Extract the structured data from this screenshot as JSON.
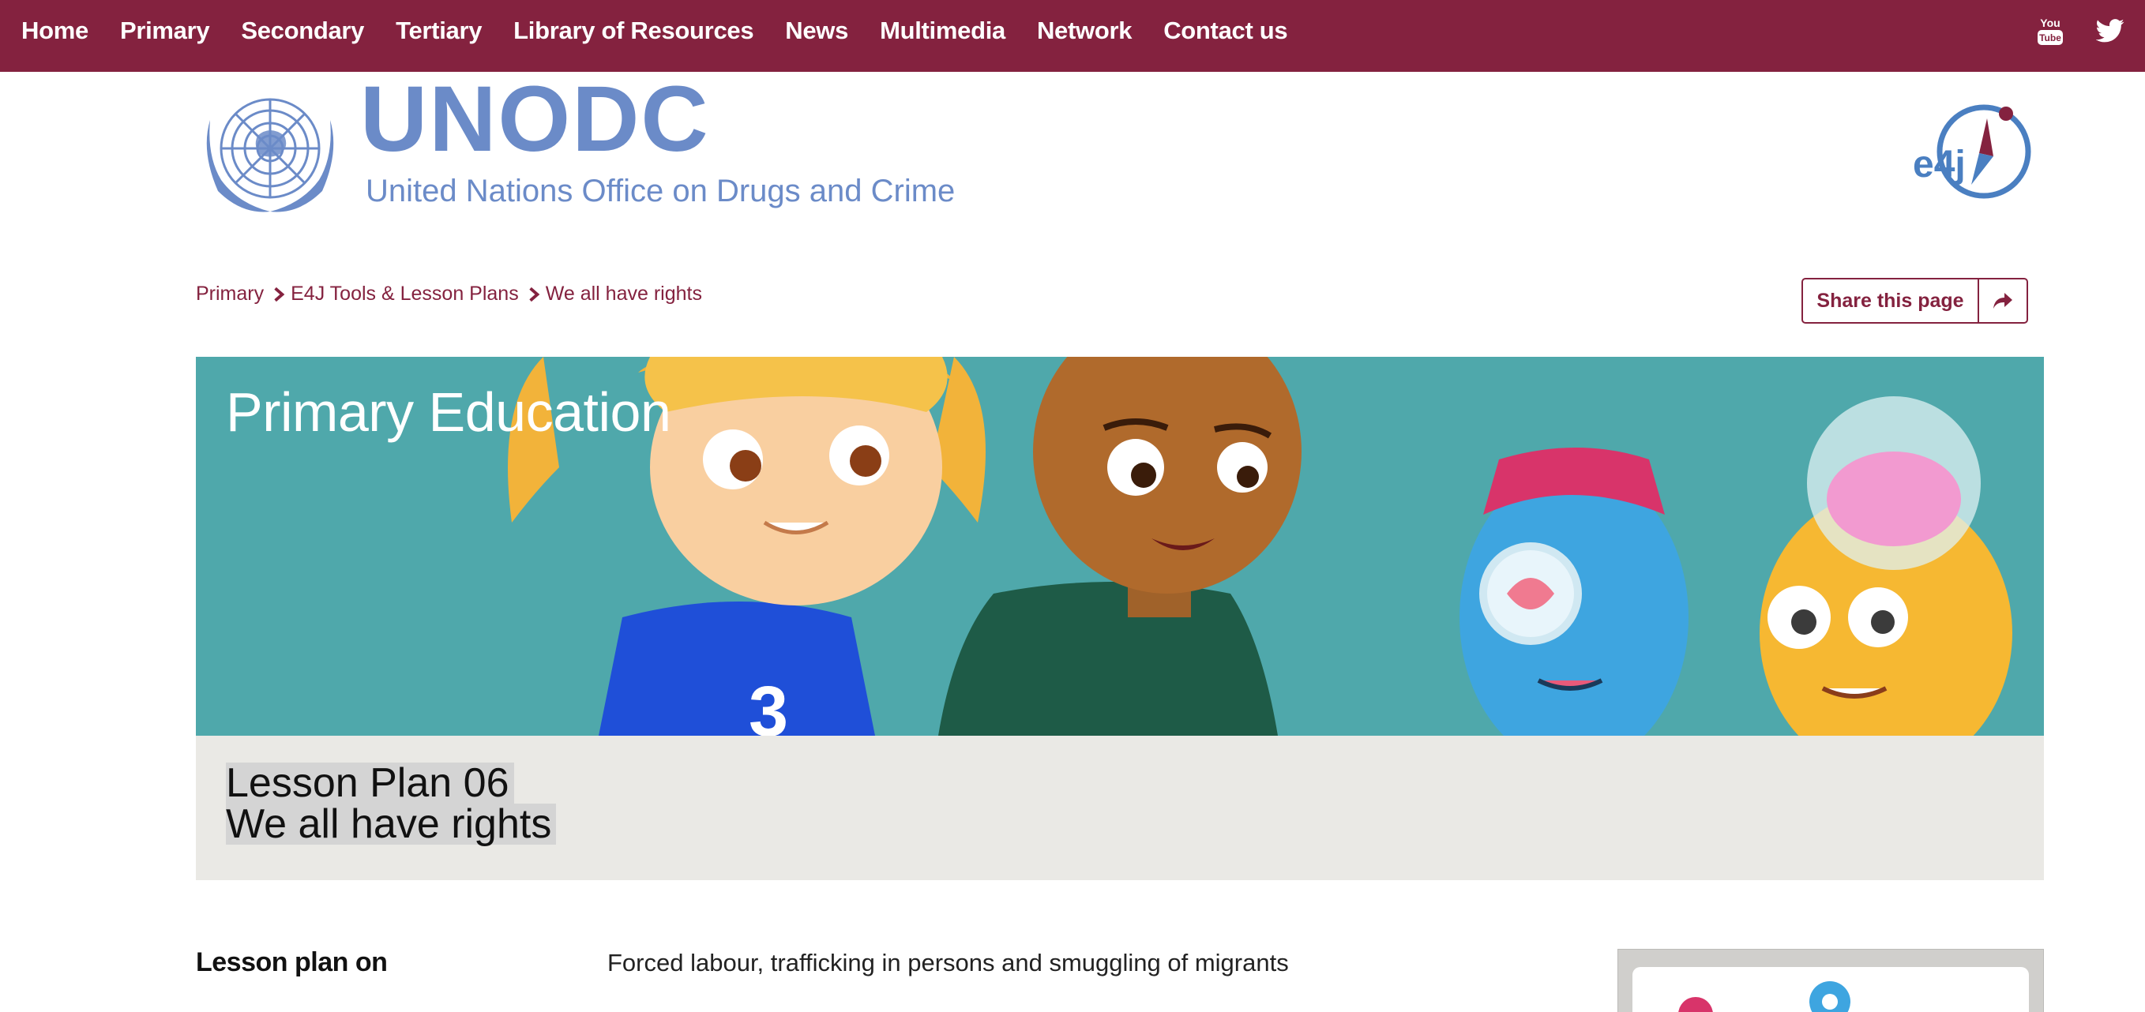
{
  "nav": {
    "items": [
      {
        "label": "Home"
      },
      {
        "label": "Primary"
      },
      {
        "label": "Secondary"
      },
      {
        "label": "Tertiary"
      },
      {
        "label": "Library of Resources"
      },
      {
        "label": "News"
      },
      {
        "label": "Multimedia"
      },
      {
        "label": "Network"
      },
      {
        "label": "Contact us"
      }
    ],
    "social": [
      "youtube-icon",
      "twitter-icon"
    ],
    "background": "#84223f"
  },
  "header": {
    "org_acronym": "UNODC",
    "org_name": "United Nations Office on Drugs and Crime",
    "partner_logo": "e4j",
    "brand_color": "#6b8bc8"
  },
  "breadcrumb": {
    "items": [
      {
        "label": "Primary"
      },
      {
        "label": "E4J Tools & Lesson Plans"
      },
      {
        "label": "We all have rights"
      }
    ]
  },
  "share": {
    "label": "Share this page",
    "icon": "share-arrow-icon"
  },
  "banner": {
    "title": "Primary Education",
    "background": "#4fa8ab"
  },
  "lesson": {
    "number_line": "Lesson Plan 06",
    "title_line": "We all have rights"
  },
  "details": {
    "label": "Lesson plan on",
    "value": "Forced labour, trafficking in persons and smuggling of migrants"
  }
}
